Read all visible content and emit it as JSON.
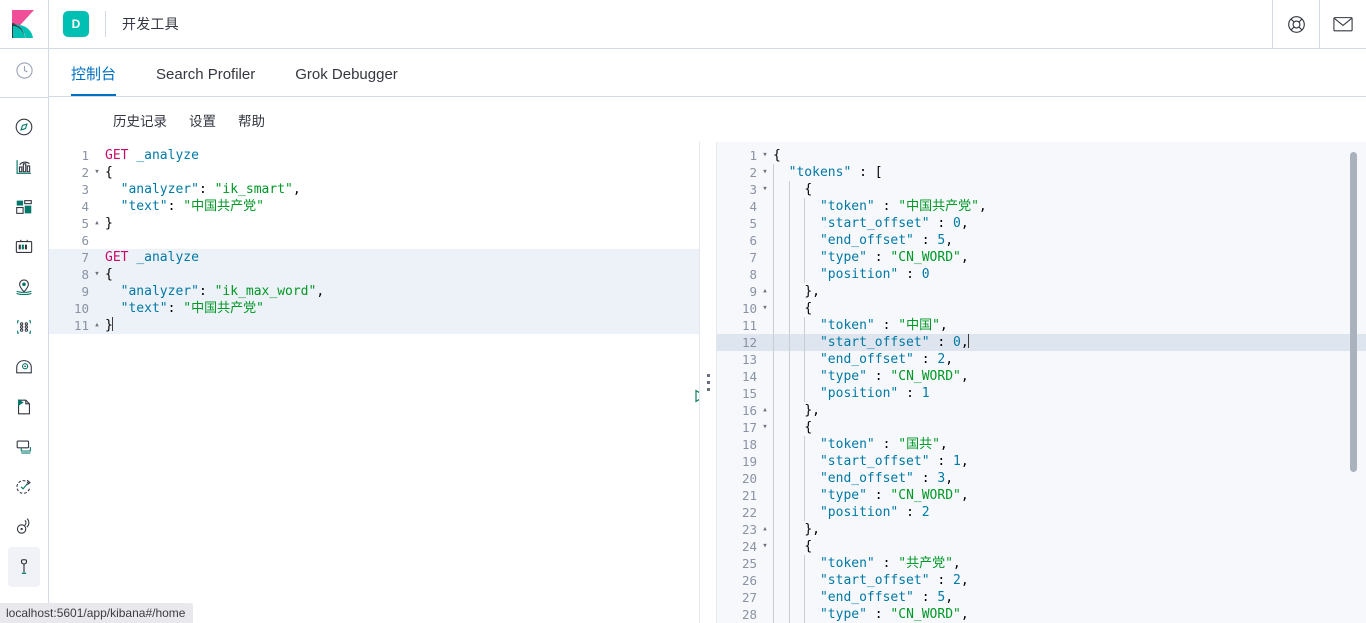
{
  "header": {
    "logo_icon": "kibana-logo",
    "app_badge": "D",
    "title": "开发工具",
    "help_icon": "life-ring-icon",
    "mail_icon": "mail-icon"
  },
  "sidebar": {
    "recent_icon": "clock-recent-icon",
    "items": [
      {
        "icon": "compass-discover-icon",
        "name": "discover",
        "active": false
      },
      {
        "icon": "bar-chart-visualize-icon",
        "name": "visualize",
        "active": false
      },
      {
        "icon": "dashboard-icon",
        "name": "dashboard",
        "active": false
      },
      {
        "icon": "canvas-icon",
        "name": "canvas",
        "active": false
      },
      {
        "icon": "maps-pin-icon",
        "name": "maps",
        "active": false
      },
      {
        "icon": "machine-learning-icon",
        "name": "machine-learning",
        "active": false
      },
      {
        "icon": "infrastructure-icon",
        "name": "infrastructure",
        "active": false
      },
      {
        "icon": "logs-icon",
        "name": "logs",
        "active": false
      },
      {
        "icon": "apm-icon",
        "name": "apm",
        "active": false
      },
      {
        "icon": "uptime-icon",
        "name": "uptime",
        "active": false
      },
      {
        "icon": "siem-icon",
        "name": "siem",
        "active": false
      },
      {
        "icon": "wrench-devtools-icon",
        "name": "dev-tools",
        "active": true
      }
    ]
  },
  "tabs": [
    {
      "label": "控制台",
      "active": true
    },
    {
      "label": "Search Profiler",
      "active": false
    },
    {
      "label": "Grok Debugger",
      "active": false
    }
  ],
  "submenu": [
    {
      "label": "历史记录"
    },
    {
      "label": "设置"
    },
    {
      "label": "帮助"
    }
  ],
  "editor_actions": {
    "play_icon": "play-send-request-icon",
    "wrench_icon": "wrench-request-options-icon"
  },
  "request_editor": {
    "highlight_line": 7,
    "highlight_range": [
      7,
      11
    ],
    "caret_line": 11,
    "lines": [
      {
        "n": 1,
        "fold": "",
        "tokens": [
          {
            "t": "method",
            "v": "GET"
          },
          {
            "t": "plain",
            "v": " "
          },
          {
            "t": "url",
            "v": "_analyze"
          }
        ]
      },
      {
        "n": 2,
        "fold": "▾",
        "tokens": [
          {
            "t": "punc",
            "v": "{"
          }
        ]
      },
      {
        "n": 3,
        "fold": "",
        "tokens": [
          {
            "t": "plain",
            "v": "  "
          },
          {
            "t": "key",
            "v": "\"analyzer\""
          },
          {
            "t": "punc",
            "v": ": "
          },
          {
            "t": "strg",
            "v": "\"ik_smart\""
          },
          {
            "t": "punc",
            "v": ","
          }
        ]
      },
      {
        "n": 4,
        "fold": "",
        "tokens": [
          {
            "t": "plain",
            "v": "  "
          },
          {
            "t": "key",
            "v": "\"text\""
          },
          {
            "t": "punc",
            "v": ": "
          },
          {
            "t": "strg",
            "v": "\"中国共产党\""
          }
        ]
      },
      {
        "n": 5,
        "fold": "▴",
        "tokens": [
          {
            "t": "punc",
            "v": "}"
          }
        ]
      },
      {
        "n": 6,
        "fold": "",
        "tokens": []
      },
      {
        "n": 7,
        "fold": "",
        "tokens": [
          {
            "t": "method",
            "v": "GET"
          },
          {
            "t": "plain",
            "v": " "
          },
          {
            "t": "url",
            "v": "_analyze"
          }
        ]
      },
      {
        "n": 8,
        "fold": "▾",
        "tokens": [
          {
            "t": "punc",
            "v": "{"
          }
        ]
      },
      {
        "n": 9,
        "fold": "",
        "tokens": [
          {
            "t": "plain",
            "v": "  "
          },
          {
            "t": "key",
            "v": "\"analyzer\""
          },
          {
            "t": "punc",
            "v": ": "
          },
          {
            "t": "strg",
            "v": "\"ik_max_word\""
          },
          {
            "t": "punc",
            "v": ","
          }
        ]
      },
      {
        "n": 10,
        "fold": "",
        "tokens": [
          {
            "t": "plain",
            "v": "  "
          },
          {
            "t": "key",
            "v": "\"text\""
          },
          {
            "t": "punc",
            "v": ": "
          },
          {
            "t": "strg",
            "v": "\"中国共产党\""
          }
        ]
      },
      {
        "n": 11,
        "fold": "▴",
        "tokens": [
          {
            "t": "punc",
            "v": "}"
          }
        ]
      }
    ]
  },
  "response_editor": {
    "highlight_line": 12,
    "caret_line": 12,
    "scrollbar": true,
    "lines": [
      {
        "n": 1,
        "fold": "▾",
        "guides": 0,
        "tokens": [
          {
            "t": "punc",
            "v": "{"
          }
        ]
      },
      {
        "n": 2,
        "fold": "▾",
        "guides": 1,
        "tokens": [
          {
            "t": "plain",
            "v": "  "
          },
          {
            "t": "key",
            "v": "\"tokens\""
          },
          {
            "t": "punc",
            "v": " : ["
          }
        ]
      },
      {
        "n": 3,
        "fold": "▾",
        "guides": 2,
        "tokens": [
          {
            "t": "plain",
            "v": "    "
          },
          {
            "t": "punc",
            "v": "{"
          }
        ]
      },
      {
        "n": 4,
        "fold": "",
        "guides": 3,
        "tokens": [
          {
            "t": "plain",
            "v": "      "
          },
          {
            "t": "key",
            "v": "\"token\""
          },
          {
            "t": "punc",
            "v": " : "
          },
          {
            "t": "strg",
            "v": "\"中国共产党\""
          },
          {
            "t": "punc",
            "v": ","
          }
        ]
      },
      {
        "n": 5,
        "fold": "",
        "guides": 3,
        "tokens": [
          {
            "t": "plain",
            "v": "      "
          },
          {
            "t": "key",
            "v": "\"start_offset\""
          },
          {
            "t": "punc",
            "v": " : "
          },
          {
            "t": "num",
            "v": "0"
          },
          {
            "t": "punc",
            "v": ","
          }
        ]
      },
      {
        "n": 6,
        "fold": "",
        "guides": 3,
        "tokens": [
          {
            "t": "plain",
            "v": "      "
          },
          {
            "t": "key",
            "v": "\"end_offset\""
          },
          {
            "t": "punc",
            "v": " : "
          },
          {
            "t": "num",
            "v": "5"
          },
          {
            "t": "punc",
            "v": ","
          }
        ]
      },
      {
        "n": 7,
        "fold": "",
        "guides": 3,
        "tokens": [
          {
            "t": "plain",
            "v": "      "
          },
          {
            "t": "key",
            "v": "\"type\""
          },
          {
            "t": "punc",
            "v": " : "
          },
          {
            "t": "strg",
            "v": "\"CN_WORD\""
          },
          {
            "t": "punc",
            "v": ","
          }
        ]
      },
      {
        "n": 8,
        "fold": "",
        "guides": 3,
        "tokens": [
          {
            "t": "plain",
            "v": "      "
          },
          {
            "t": "key",
            "v": "\"position\""
          },
          {
            "t": "punc",
            "v": " : "
          },
          {
            "t": "num",
            "v": "0"
          }
        ]
      },
      {
        "n": 9,
        "fold": "▴",
        "guides": 2,
        "tokens": [
          {
            "t": "plain",
            "v": "    "
          },
          {
            "t": "punc",
            "v": "},"
          }
        ]
      },
      {
        "n": 10,
        "fold": "▾",
        "guides": 2,
        "tokens": [
          {
            "t": "plain",
            "v": "    "
          },
          {
            "t": "punc",
            "v": "{"
          }
        ]
      },
      {
        "n": 11,
        "fold": "",
        "guides": 3,
        "tokens": [
          {
            "t": "plain",
            "v": "      "
          },
          {
            "t": "key",
            "v": "\"token\""
          },
          {
            "t": "punc",
            "v": " : "
          },
          {
            "t": "strg",
            "v": "\"中国\""
          },
          {
            "t": "punc",
            "v": ","
          }
        ]
      },
      {
        "n": 12,
        "fold": "",
        "guides": 3,
        "tokens": [
          {
            "t": "plain",
            "v": "      "
          },
          {
            "t": "key",
            "v": "\"start_offset\""
          },
          {
            "t": "punc",
            "v": " : "
          },
          {
            "t": "num",
            "v": "0"
          },
          {
            "t": "punc",
            "v": ","
          }
        ]
      },
      {
        "n": 13,
        "fold": "",
        "guides": 3,
        "tokens": [
          {
            "t": "plain",
            "v": "      "
          },
          {
            "t": "key",
            "v": "\"end_offset\""
          },
          {
            "t": "punc",
            "v": " : "
          },
          {
            "t": "num",
            "v": "2"
          },
          {
            "t": "punc",
            "v": ","
          }
        ]
      },
      {
        "n": 14,
        "fold": "",
        "guides": 3,
        "tokens": [
          {
            "t": "plain",
            "v": "      "
          },
          {
            "t": "key",
            "v": "\"type\""
          },
          {
            "t": "punc",
            "v": " : "
          },
          {
            "t": "strg",
            "v": "\"CN_WORD\""
          },
          {
            "t": "punc",
            "v": ","
          }
        ]
      },
      {
        "n": 15,
        "fold": "",
        "guides": 3,
        "tokens": [
          {
            "t": "plain",
            "v": "      "
          },
          {
            "t": "key",
            "v": "\"position\""
          },
          {
            "t": "punc",
            "v": " : "
          },
          {
            "t": "num",
            "v": "1"
          }
        ]
      },
      {
        "n": 16,
        "fold": "▴",
        "guides": 2,
        "tokens": [
          {
            "t": "plain",
            "v": "    "
          },
          {
            "t": "punc",
            "v": "},"
          }
        ]
      },
      {
        "n": 17,
        "fold": "▾",
        "guides": 2,
        "tokens": [
          {
            "t": "plain",
            "v": "    "
          },
          {
            "t": "punc",
            "v": "{"
          }
        ]
      },
      {
        "n": 18,
        "fold": "",
        "guides": 3,
        "tokens": [
          {
            "t": "plain",
            "v": "      "
          },
          {
            "t": "key",
            "v": "\"token\""
          },
          {
            "t": "punc",
            "v": " : "
          },
          {
            "t": "strg",
            "v": "\"国共\""
          },
          {
            "t": "punc",
            "v": ","
          }
        ]
      },
      {
        "n": 19,
        "fold": "",
        "guides": 3,
        "tokens": [
          {
            "t": "plain",
            "v": "      "
          },
          {
            "t": "key",
            "v": "\"start_offset\""
          },
          {
            "t": "punc",
            "v": " : "
          },
          {
            "t": "num",
            "v": "1"
          },
          {
            "t": "punc",
            "v": ","
          }
        ]
      },
      {
        "n": 20,
        "fold": "",
        "guides": 3,
        "tokens": [
          {
            "t": "plain",
            "v": "      "
          },
          {
            "t": "key",
            "v": "\"end_offset\""
          },
          {
            "t": "punc",
            "v": " : "
          },
          {
            "t": "num",
            "v": "3"
          },
          {
            "t": "punc",
            "v": ","
          }
        ]
      },
      {
        "n": 21,
        "fold": "",
        "guides": 3,
        "tokens": [
          {
            "t": "plain",
            "v": "      "
          },
          {
            "t": "key",
            "v": "\"type\""
          },
          {
            "t": "punc",
            "v": " : "
          },
          {
            "t": "strg",
            "v": "\"CN_WORD\""
          },
          {
            "t": "punc",
            "v": ","
          }
        ]
      },
      {
        "n": 22,
        "fold": "",
        "guides": 3,
        "tokens": [
          {
            "t": "plain",
            "v": "      "
          },
          {
            "t": "key",
            "v": "\"position\""
          },
          {
            "t": "punc",
            "v": " : "
          },
          {
            "t": "num",
            "v": "2"
          }
        ]
      },
      {
        "n": 23,
        "fold": "▴",
        "guides": 2,
        "tokens": [
          {
            "t": "plain",
            "v": "    "
          },
          {
            "t": "punc",
            "v": "},"
          }
        ]
      },
      {
        "n": 24,
        "fold": "▾",
        "guides": 2,
        "tokens": [
          {
            "t": "plain",
            "v": "    "
          },
          {
            "t": "punc",
            "v": "{"
          }
        ]
      },
      {
        "n": 25,
        "fold": "",
        "guides": 3,
        "tokens": [
          {
            "t": "plain",
            "v": "      "
          },
          {
            "t": "key",
            "v": "\"token\""
          },
          {
            "t": "punc",
            "v": " : "
          },
          {
            "t": "strg",
            "v": "\"共产党\""
          },
          {
            "t": "punc",
            "v": ","
          }
        ]
      },
      {
        "n": 26,
        "fold": "",
        "guides": 3,
        "tokens": [
          {
            "t": "plain",
            "v": "      "
          },
          {
            "t": "key",
            "v": "\"start_offset\""
          },
          {
            "t": "punc",
            "v": " : "
          },
          {
            "t": "num",
            "v": "2"
          },
          {
            "t": "punc",
            "v": ","
          }
        ]
      },
      {
        "n": 27,
        "fold": "",
        "guides": 3,
        "tokens": [
          {
            "t": "plain",
            "v": "      "
          },
          {
            "t": "key",
            "v": "\"end_offset\""
          },
          {
            "t": "punc",
            "v": " : "
          },
          {
            "t": "num",
            "v": "5"
          },
          {
            "t": "punc",
            "v": ","
          }
        ]
      },
      {
        "n": 28,
        "fold": "",
        "guides": 3,
        "tokens": [
          {
            "t": "plain",
            "v": "      "
          },
          {
            "t": "key",
            "v": "\"type\""
          },
          {
            "t": "punc",
            "v": " : "
          },
          {
            "t": "strg",
            "v": "\"CN_WORD\""
          },
          {
            "t": "punc",
            "v": ","
          }
        ]
      }
    ]
  },
  "statusbar": {
    "url": "localhost:5601/app/kibana#/home"
  },
  "colors": {
    "accent": "#0071c2",
    "brand_teal": "#00bfb3",
    "brand_pink": "#f04e98",
    "method": "#c80a68",
    "string": "#009926",
    "key": "#0079a5"
  }
}
